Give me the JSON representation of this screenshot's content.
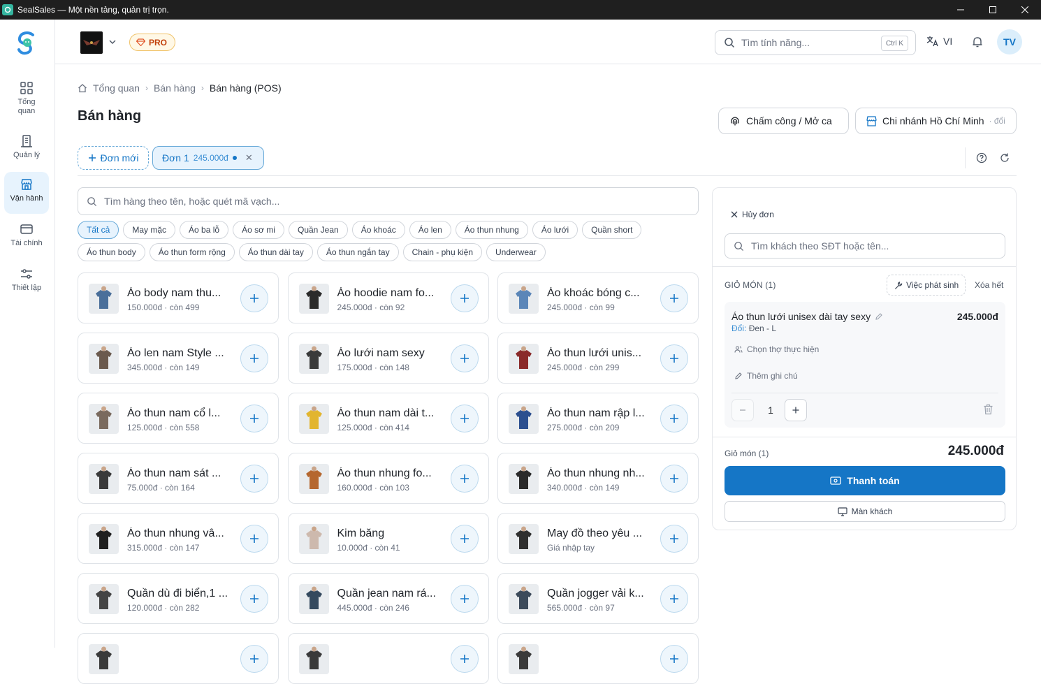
{
  "window": {
    "title": "SealSales — Một nền tảng, quản trị trọn."
  },
  "sidebar": {
    "items": [
      {
        "label": "Tổng\nquan",
        "icon": "grid-icon",
        "active": false
      },
      {
        "label": "Quản lý",
        "icon": "building-icon",
        "active": false
      },
      {
        "label": "Vận hành",
        "icon": "store-icon",
        "active": true
      },
      {
        "label": "Tài chính",
        "icon": "card-icon",
        "active": false
      },
      {
        "label": "Thiết lập",
        "icon": "sliders-icon",
        "active": false
      }
    ]
  },
  "header": {
    "badge": "PRO",
    "search_placeholder": "Tìm tính năng...",
    "shortcut": "Ctrl K",
    "language": "VI",
    "avatar_initials": "TV"
  },
  "breadcrumb": [
    "Tổng quan",
    "Bán hàng",
    "Bán hàng (POS)"
  ],
  "page": {
    "title": "Bán hàng",
    "timekeeping_label": "Chấm công / Mở ca",
    "branch_label": "Chi nhánh Hồ Chí Minh",
    "branch_change": "· đổi"
  },
  "order_tabs": {
    "new_label": "Đơn mới",
    "orders": [
      {
        "label": "Đơn 1",
        "amount": "245.000đ"
      }
    ]
  },
  "product_search": {
    "placeholder": "Tìm hàng theo tên, hoặc quét mã vạch..."
  },
  "categories": [
    [
      "Tất cả",
      "May mặc",
      "Áo ba lỗ",
      "Áo sơ mi",
      "Quần Jean",
      "Áo khoác",
      "Áo len",
      "Áo thun nhung",
      "Áo lưới",
      "Quần short"
    ],
    [
      "Áo thun body",
      "Áo thun form rộng",
      "Áo thun dài tay",
      "Áo thun ngắn tay",
      "Chain - phụ kiện",
      "Underwear"
    ]
  ],
  "active_category": "Tất cả",
  "products": [
    {
      "name": "Áo body nam thu...",
      "meta": "150.000đ · còn 499",
      "thumb": "#4a6f9a"
    },
    {
      "name": "Áo hoodie nam fo...",
      "meta": "245.000đ · còn 92",
      "thumb": "#2b2b2b"
    },
    {
      "name": "Áo khoác bóng c...",
      "meta": "245.000đ · còn 99",
      "thumb": "#5b86b8"
    },
    {
      "name": "Áo len nam Style ...",
      "meta": "345.000đ · còn 149",
      "thumb": "#6b5a4e"
    },
    {
      "name": "Áo lưới nam sexy",
      "meta": "175.000đ · còn 148",
      "thumb": "#3a3a3a"
    },
    {
      "name": "Áo thun lưới unis...",
      "meta": "245.000đ · còn 299",
      "thumb": "#8a2a2a"
    },
    {
      "name": "Áo thun nam cổ l...",
      "meta": "125.000đ · còn 558",
      "thumb": "#7a6a5e"
    },
    {
      "name": "Áo thun nam dài t...",
      "meta": "125.000đ · còn 414",
      "thumb": "#e2b52f"
    },
    {
      "name": "Áo thun nam rập l...",
      "meta": "275.000đ · còn 209",
      "thumb": "#2c4f8f"
    },
    {
      "name": "Áo thun nam sát ...",
      "meta": "75.000đ · còn 164",
      "thumb": "#3a3a3a"
    },
    {
      "name": "Áo thun nhung fo...",
      "meta": "160.000đ · còn 103",
      "thumb": "#b5672f"
    },
    {
      "name": "Áo thun nhung nh...",
      "meta": "340.000đ · còn 149",
      "thumb": "#2a2a2a"
    },
    {
      "name": "Áo thun nhung vâ...",
      "meta": "315.000đ · còn 147",
      "thumb": "#1f1f1f"
    },
    {
      "name": "Kim băng",
      "meta": "10.000đ · còn 41",
      "thumb": "#cdb9ad"
    },
    {
      "name": "May đồ theo yêu ...",
      "meta": "Giá nhập tay",
      "thumb": "#2f2f2f"
    },
    {
      "name": "Quần dù đi biển,1 ...",
      "meta": "120.000đ · còn 282",
      "thumb": "#444444"
    },
    {
      "name": "Quần jean nam rá...",
      "meta": "445.000đ · còn 246",
      "thumb": "#34495e"
    },
    {
      "name": "Quần jogger vải k...",
      "meta": "565.000đ · còn 97",
      "thumb": "#3c4a5a"
    },
    {
      "name": "",
      "meta": "",
      "thumb": "#3a3a3a"
    },
    {
      "name": "",
      "meta": "",
      "thumb": "#3a3a3a"
    },
    {
      "name": "",
      "meta": "",
      "thumb": "#3a3a3a"
    }
  ],
  "cart": {
    "cancel_label": "Hủy đơn",
    "customer_search_placeholder": "Tìm khách theo SĐT hoặc tên...",
    "heading": "GIỎ MÓN (1)",
    "misc_label": "Việc phát sinh",
    "clear_label": "Xóa hết",
    "item": {
      "name": "Áo thun lưới unisex dài tay sexy",
      "price": "245.000đ",
      "variant_label": "Đổi:",
      "variant_value": "Đen - L",
      "staff_label": "Chọn thợ thực hiện",
      "note_label": "Thêm ghi chú",
      "quantity": "1"
    },
    "total_label": "Giỏ món (1)",
    "total_value": "245.000đ",
    "pay_label": "Thanh toán",
    "customer_screen_label": "Màn khách"
  },
  "colors": {
    "accent": "#1576c6",
    "accent_light": "#e7f3fd",
    "pro": "#c2410c"
  }
}
